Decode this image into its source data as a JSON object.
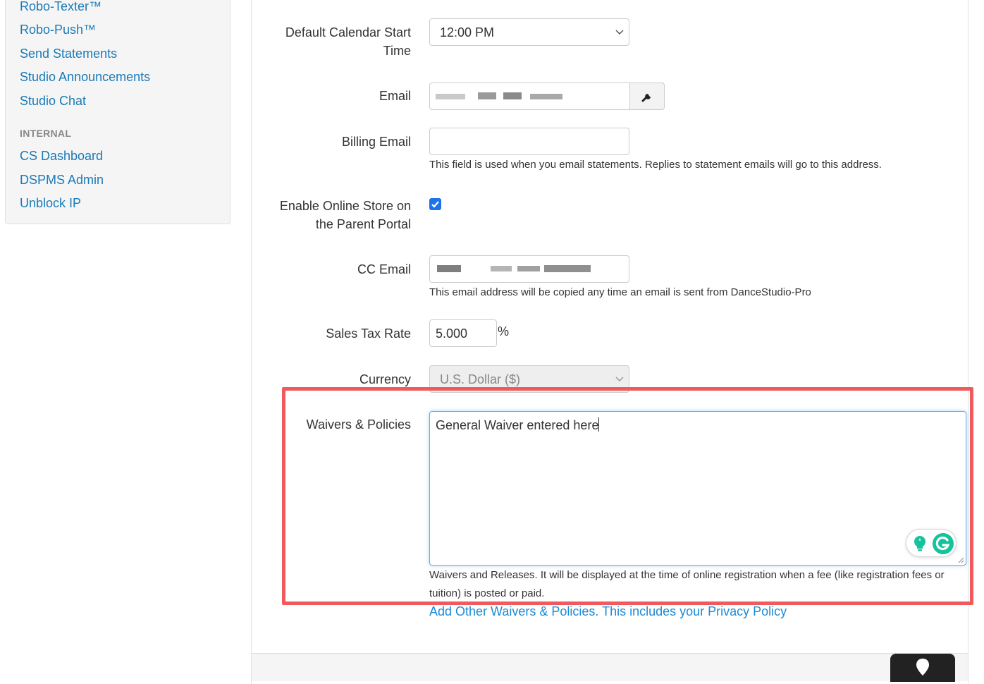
{
  "sidebar": {
    "items": [
      {
        "label": "Robo-Texter™"
      },
      {
        "label": "Robo-Push™"
      },
      {
        "label": "Send Statements"
      },
      {
        "label": "Studio Announcements"
      },
      {
        "label": "Studio Chat"
      }
    ],
    "internal_header": "INTERNAL",
    "internal_items": [
      {
        "label": "CS Dashboard"
      },
      {
        "label": "DSPMS Admin"
      },
      {
        "label": "Unblock IP"
      }
    ]
  },
  "form": {
    "calendar_start": {
      "label": "Default Calendar Start Time",
      "value": "12:00 PM"
    },
    "email": {
      "label": "Email"
    },
    "billing_email": {
      "label": "Billing Email",
      "value": "",
      "help": "This field is used when you email statements. Replies to statement emails will go to this address."
    },
    "online_store": {
      "label": "Enable Online Store on the Parent Portal",
      "checked": true
    },
    "cc_email": {
      "label": "CC Email",
      "help": "This email address will be copied any time an email is sent from DanceStudio-Pro"
    },
    "sales_tax": {
      "label": "Sales Tax Rate",
      "value": "5.000",
      "suffix": "%"
    },
    "currency": {
      "label": "Currency",
      "value": "U.S. Dollar ($)"
    },
    "waivers": {
      "label": "Waivers & Policies",
      "value": "General Waiver entered here",
      "help": "Waivers and Releases. It will be displayed at the time of online registration when a fee (like registration fees or tuition) is posted or paid.",
      "link": "Add Other Waivers & Policies. This includes your Privacy Policy"
    }
  },
  "colors": {
    "link": "#1a7ab8",
    "highlight": "#f05a5c",
    "checkbox": "#1e73e8",
    "grammarly": "#15c39a"
  }
}
